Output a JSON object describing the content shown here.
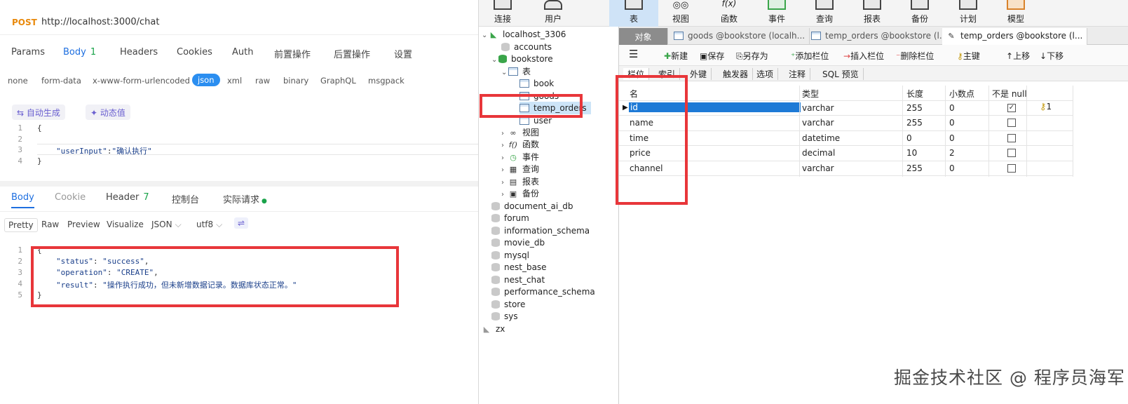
{
  "request": {
    "method": "POST",
    "url": "http://localhost:3000/chat",
    "tabs": [
      {
        "label": "Params"
      },
      {
        "label": "Body",
        "count": "1",
        "active": true
      },
      {
        "label": "Headers"
      },
      {
        "label": "Cookies"
      },
      {
        "label": "Auth"
      },
      {
        "label": "前置操作"
      },
      {
        "label": "后置操作"
      },
      {
        "label": "设置"
      }
    ],
    "body_types": [
      "none",
      "form-data",
      "x-www-form-urlencoded",
      "json",
      "xml",
      "raw",
      "binary",
      "GraphQL",
      "msgpack"
    ],
    "selected_type": "json",
    "auto_generate_label": "自动生成",
    "dynamic_value_label": "动态值",
    "code_lines": [
      {
        "n": "1",
        "text": "{"
      },
      {
        "n": "2",
        "text": ""
      },
      {
        "n": "3",
        "key": "\"userInput\"",
        "colon": ":",
        "value": "\"确认执行\""
      },
      {
        "n": "4",
        "text": "}"
      }
    ]
  },
  "response": {
    "tabs": [
      {
        "label": "Body",
        "active": true
      },
      {
        "label": "Cookie"
      },
      {
        "label": "Header",
        "count": "7"
      },
      {
        "label": "控制台"
      },
      {
        "label": "实际请求"
      }
    ],
    "view_modes": [
      "Pretty",
      "Raw",
      "Preview",
      "Visualize"
    ],
    "format": "JSON",
    "encoding": "utf8",
    "code_lines": [
      {
        "n": "1",
        "text": "{"
      },
      {
        "n": "2",
        "key": "\"status\"",
        "value": "\"success\"",
        "comma": ","
      },
      {
        "n": "3",
        "key": "\"operation\"",
        "value": "\"CREATE\"",
        "comma": ","
      },
      {
        "n": "4",
        "key": "\"result\"",
        "value": "\"操作执行成功，但未新增数据记录。数据库状态正常。\"",
        "comma": ""
      },
      {
        "n": "5",
        "text": "}"
      }
    ]
  },
  "navicat": {
    "toolbar": [
      {
        "label": "连接"
      },
      {
        "label": "用户"
      },
      {
        "label": "表",
        "active": true
      },
      {
        "label": "视图"
      },
      {
        "label": "函数"
      },
      {
        "label": "事件"
      },
      {
        "label": "查询"
      },
      {
        "label": "报表"
      },
      {
        "label": "备份"
      },
      {
        "label": "计划"
      },
      {
        "label": "模型"
      }
    ],
    "tree": {
      "connection": "localhost_3306",
      "databases_top": [
        "accounts"
      ],
      "active_db": "bookstore",
      "tables_label": "表",
      "tables": [
        "book",
        "goods",
        "temp_orders",
        "user"
      ],
      "selected_table": "temp_orders",
      "groups": [
        "视图",
        "函数",
        "事件",
        "查询",
        "报表",
        "备份"
      ],
      "databases": [
        "document_ai_db",
        "forum",
        "information_schema",
        "movie_db",
        "mysql",
        "nest_base",
        "nest_chat",
        "performance_schema",
        "store",
        "sys"
      ],
      "other_connection": "zx"
    },
    "doc_tabs": [
      {
        "label": "对象"
      },
      {
        "label": "goods @bookstore (localh..."
      },
      {
        "label": "temp_orders @bookstore (l..."
      },
      {
        "label": "temp_orders @bookstore (l..."
      }
    ],
    "edit_toolbar": [
      "新建",
      "保存",
      "另存为",
      "添加栏位",
      "插入栏位",
      "删除栏位",
      "主键",
      "上移",
      "下移"
    ],
    "sub_tabs": [
      "栏位",
      "索引",
      "外键",
      "触发器",
      "选项",
      "注释",
      "SQL 预览"
    ],
    "columns_header": [
      "名",
      "类型",
      "长度",
      "小数点",
      "不是 null"
    ],
    "fields": [
      {
        "name": "id",
        "type": "varchar",
        "length": "255",
        "decimals": "0",
        "not_null": true,
        "key": "1"
      },
      {
        "name": "name",
        "type": "varchar",
        "length": "255",
        "decimals": "0",
        "not_null": false
      },
      {
        "name": "time",
        "type": "datetime",
        "length": "0",
        "decimals": "0",
        "not_null": false
      },
      {
        "name": "price",
        "type": "decimal",
        "length": "10",
        "decimals": "2",
        "not_null": false
      },
      {
        "name": "channel",
        "type": "varchar",
        "length": "255",
        "decimals": "0",
        "not_null": false
      }
    ]
  },
  "watermark": "掘金技术社区 @ 程序员海军",
  "colors": {
    "highlight": "#e8363a",
    "accent": "#1e6fe0",
    "method": "#e8890c"
  }
}
